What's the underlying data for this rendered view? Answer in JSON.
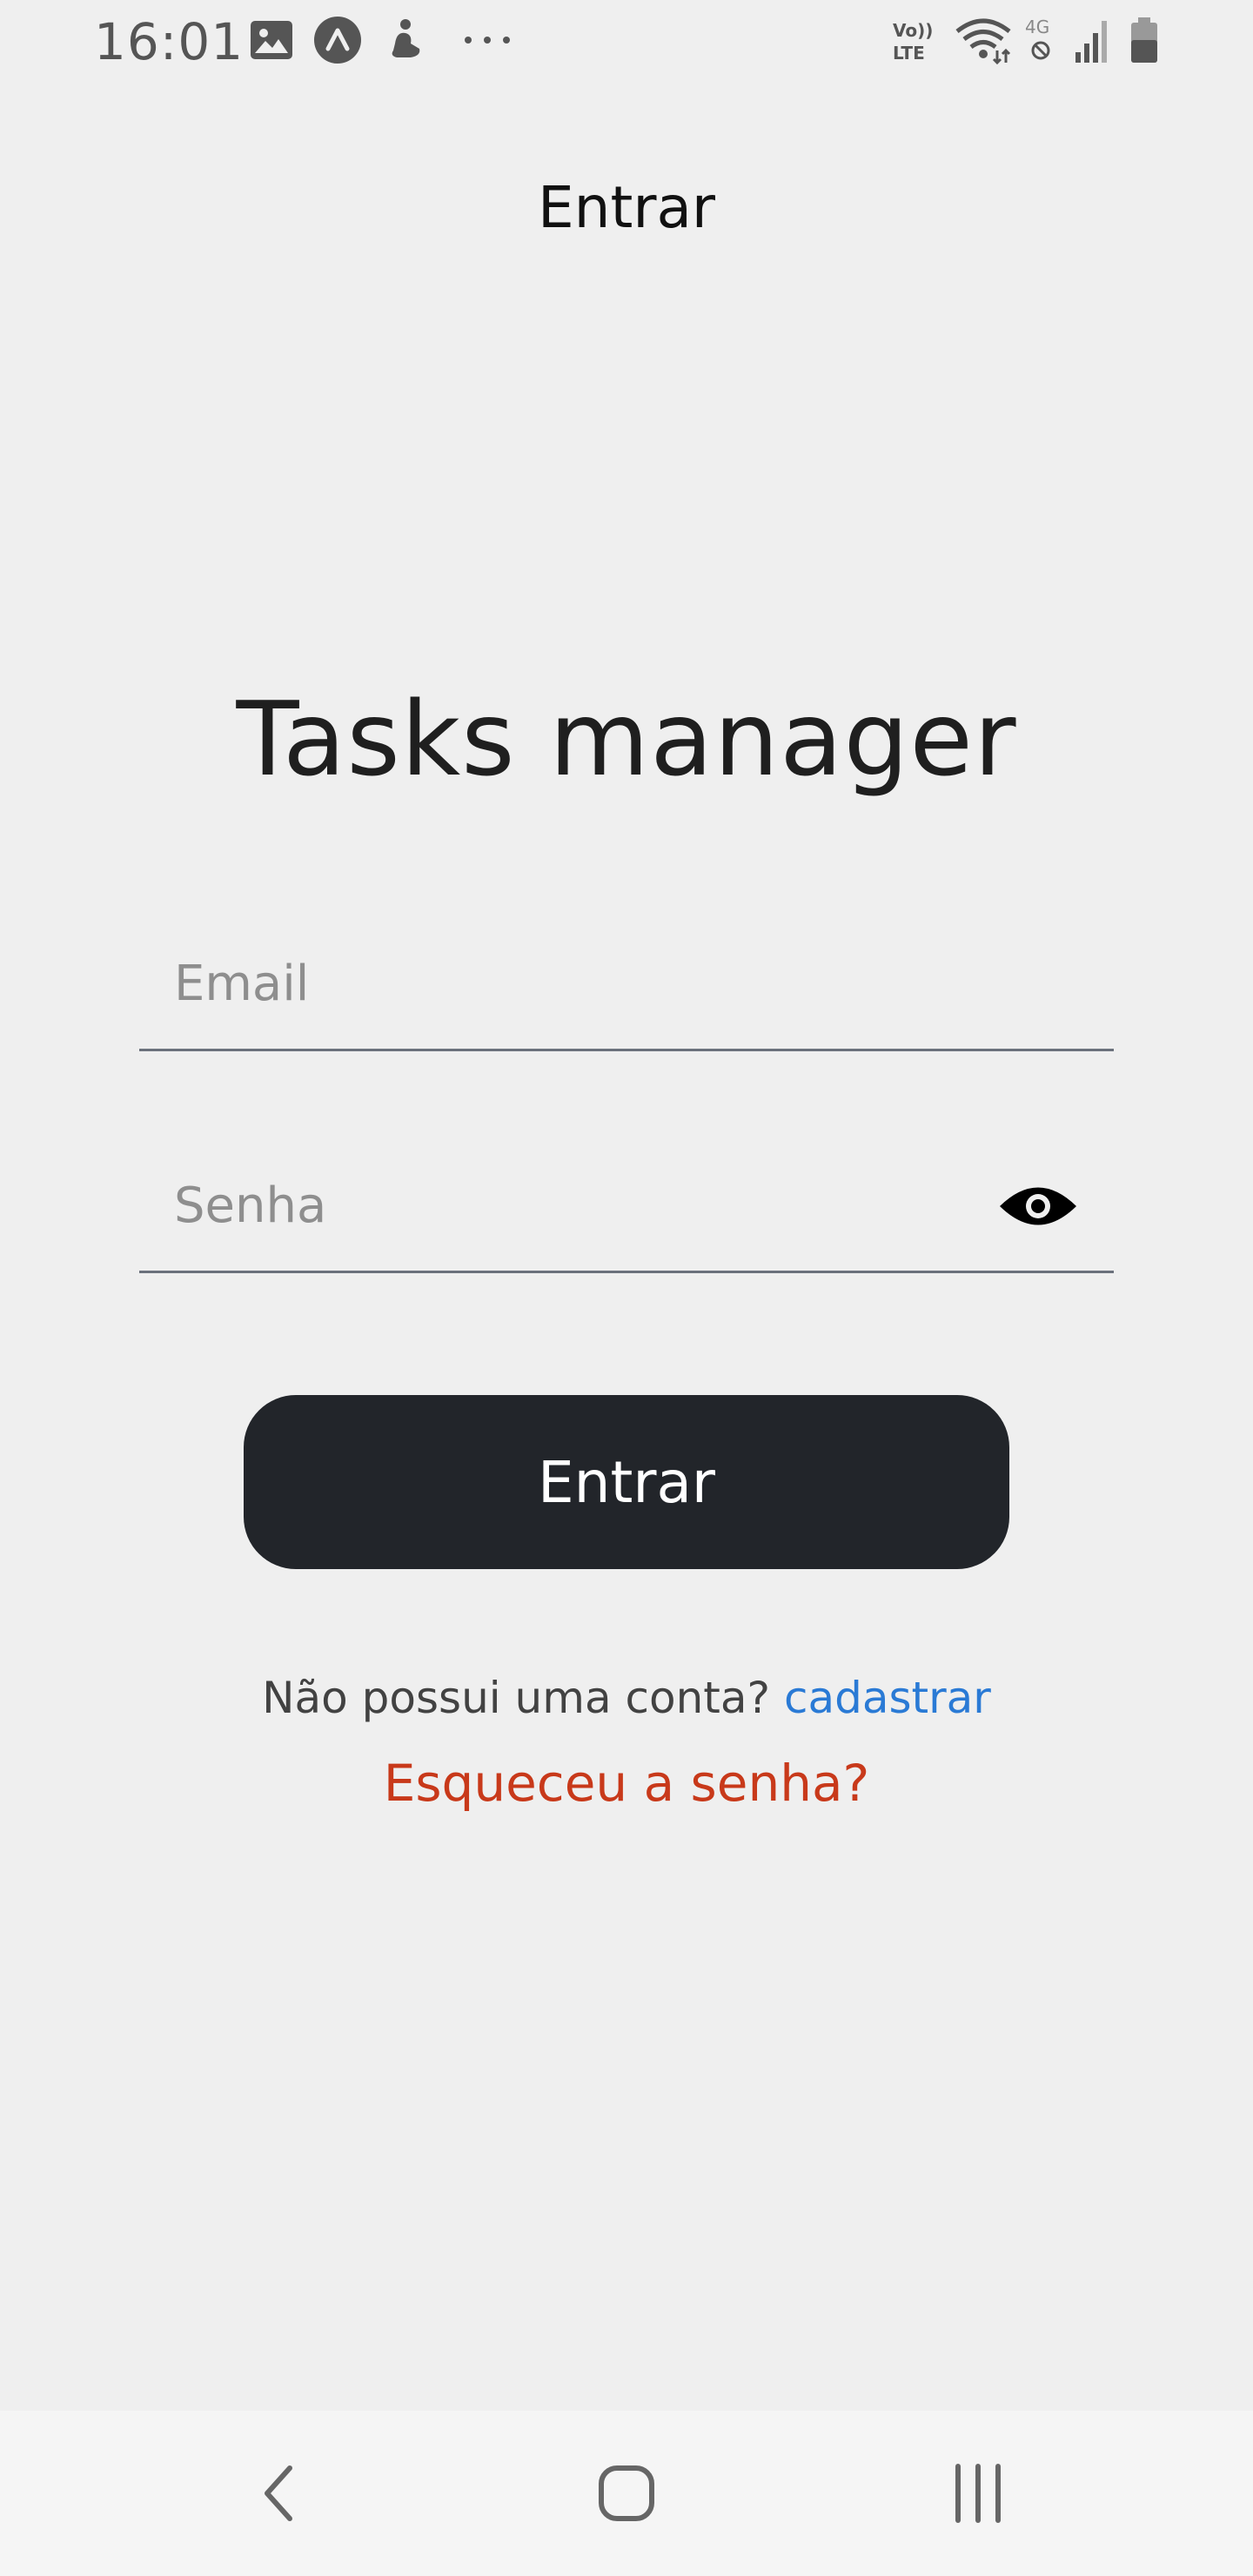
{
  "status_bar": {
    "time": "16:01",
    "left_icons": [
      "image-icon",
      "app-a-icon",
      "figure-icon",
      "more-dots-icon"
    ],
    "right_icons": [
      "volte-icon",
      "wifi-icon",
      "4g-icon",
      "signal-icon",
      "battery-icon"
    ],
    "volte_label_top": "Vo))",
    "volte_label_bottom": "LTE",
    "net_label": "4G"
  },
  "header": {
    "title": "Entrar"
  },
  "main": {
    "app_title": "Tasks manager",
    "email_field": {
      "placeholder": "Email",
      "value": ""
    },
    "password_field": {
      "placeholder": "Senha",
      "value": ""
    },
    "login_button": "Entrar",
    "signup_prompt": "Não possui uma conta?",
    "signup_link": "cadastrar",
    "forgot_link": "Esqueceu a senha?"
  },
  "colors": {
    "background": "#efefef",
    "button": "#22252a",
    "link_blue": "#2a7ad5",
    "link_red": "#c8391a",
    "underline": "#6b717c"
  }
}
